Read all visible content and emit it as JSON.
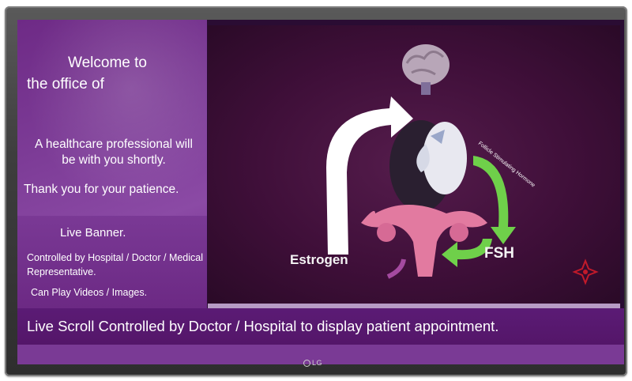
{
  "welcome": {
    "line1": "Welcome to",
    "line2": "the office of",
    "message": "A healthcare professional will be with you shortly.",
    "thanks": "Thank you for your patience."
  },
  "banner": {
    "title": "Live Banner.",
    "controlled": "Controlled by Hospital / Doctor / Medical Representative.",
    "media": "Can Play Videos / Images."
  },
  "video": {
    "label_estrogen": "Estrogen",
    "label_fsh": "FSH",
    "curve_text": "Follicle Stimulating Hormone"
  },
  "scroll": {
    "text": "Live Scroll Controlled by Doctor / Hospital to display patient appointment."
  },
  "tv": {
    "brand": "LG"
  }
}
